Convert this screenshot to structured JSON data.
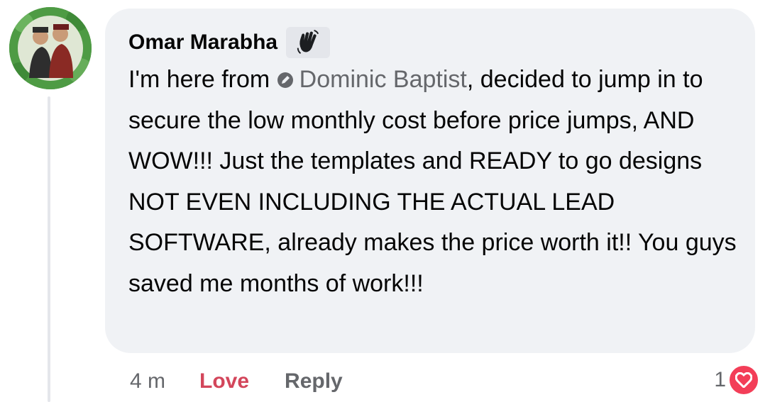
{
  "comment": {
    "author": "Omar Marabha",
    "text_before_mention": "I'm here from ",
    "mention": "Dominic Baptist",
    "text_after_mention": ", decided to jump in to secure the low monthly cost before price jumps, AND WOW!!! Just the templates and READY to go designs NOT EVEN INCLUDING THE ACTUAL LEAD SOFTWARE, already makes the price worth it!! You guys saved me months of work!!!",
    "badge_icon": "waving-hand-icon",
    "mention_icon": "pencil-circle-icon"
  },
  "actions": {
    "time": "4 m",
    "love_label": "Love",
    "reply_label": "Reply"
  },
  "reactions": {
    "count": "1",
    "icon": "heart-reaction-icon"
  },
  "colors": {
    "bubble": "#f0f2f5",
    "love": "#d3465b",
    "heart": "#f33e58",
    "meta": "#65676b"
  }
}
